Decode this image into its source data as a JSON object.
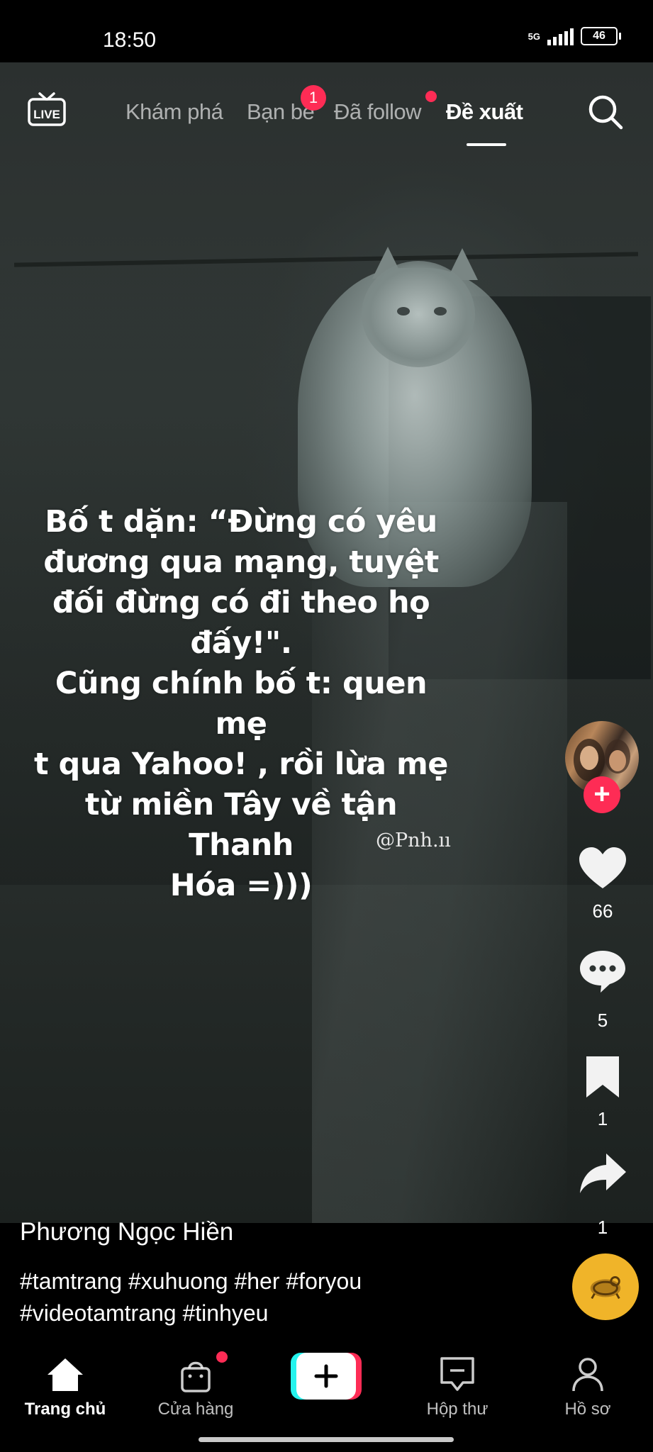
{
  "status_bar": {
    "time": "18:50",
    "network": "5G",
    "battery": "46"
  },
  "top_nav": {
    "tabs": [
      {
        "label": "Khám phá",
        "active": false
      },
      {
        "label": "Bạn bè",
        "active": false,
        "badge": "1"
      },
      {
        "label": "Đã follow",
        "active": false,
        "dot": true
      },
      {
        "label": "Đề xuất",
        "active": true
      }
    ],
    "live_label": "LIVE"
  },
  "video": {
    "caption": "Bố t dặn: “Đừng có yêu\nđương qua mạng, tuyệt\nđối đừng có đi theo họ\nđấy!\".\nCũng chính bố t: quen mẹ\nt qua Yahoo! , rồi lừa mẹ\ntừ miền Tây về tận Thanh\nHóa =)))",
    "watermark": "@Pnh.ıı",
    "author": "Phương Ngọc Hiền",
    "hashtags": "#tamtrang #xuhuong #her #foryou #videotamtrang #tinhyeu"
  },
  "actions": {
    "likes": "66",
    "comments": "5",
    "saves": "1",
    "shares": "1"
  },
  "bottom_nav": {
    "items": [
      {
        "label": "Trang chủ",
        "active": true
      },
      {
        "label": "Cửa hàng",
        "dot": true
      },
      {
        "label": "Hộp thư"
      },
      {
        "label": "Hồ sơ"
      }
    ]
  },
  "colors": {
    "accent": "#fe2c55",
    "background": "#000000",
    "music_disc": "#f0b429"
  }
}
